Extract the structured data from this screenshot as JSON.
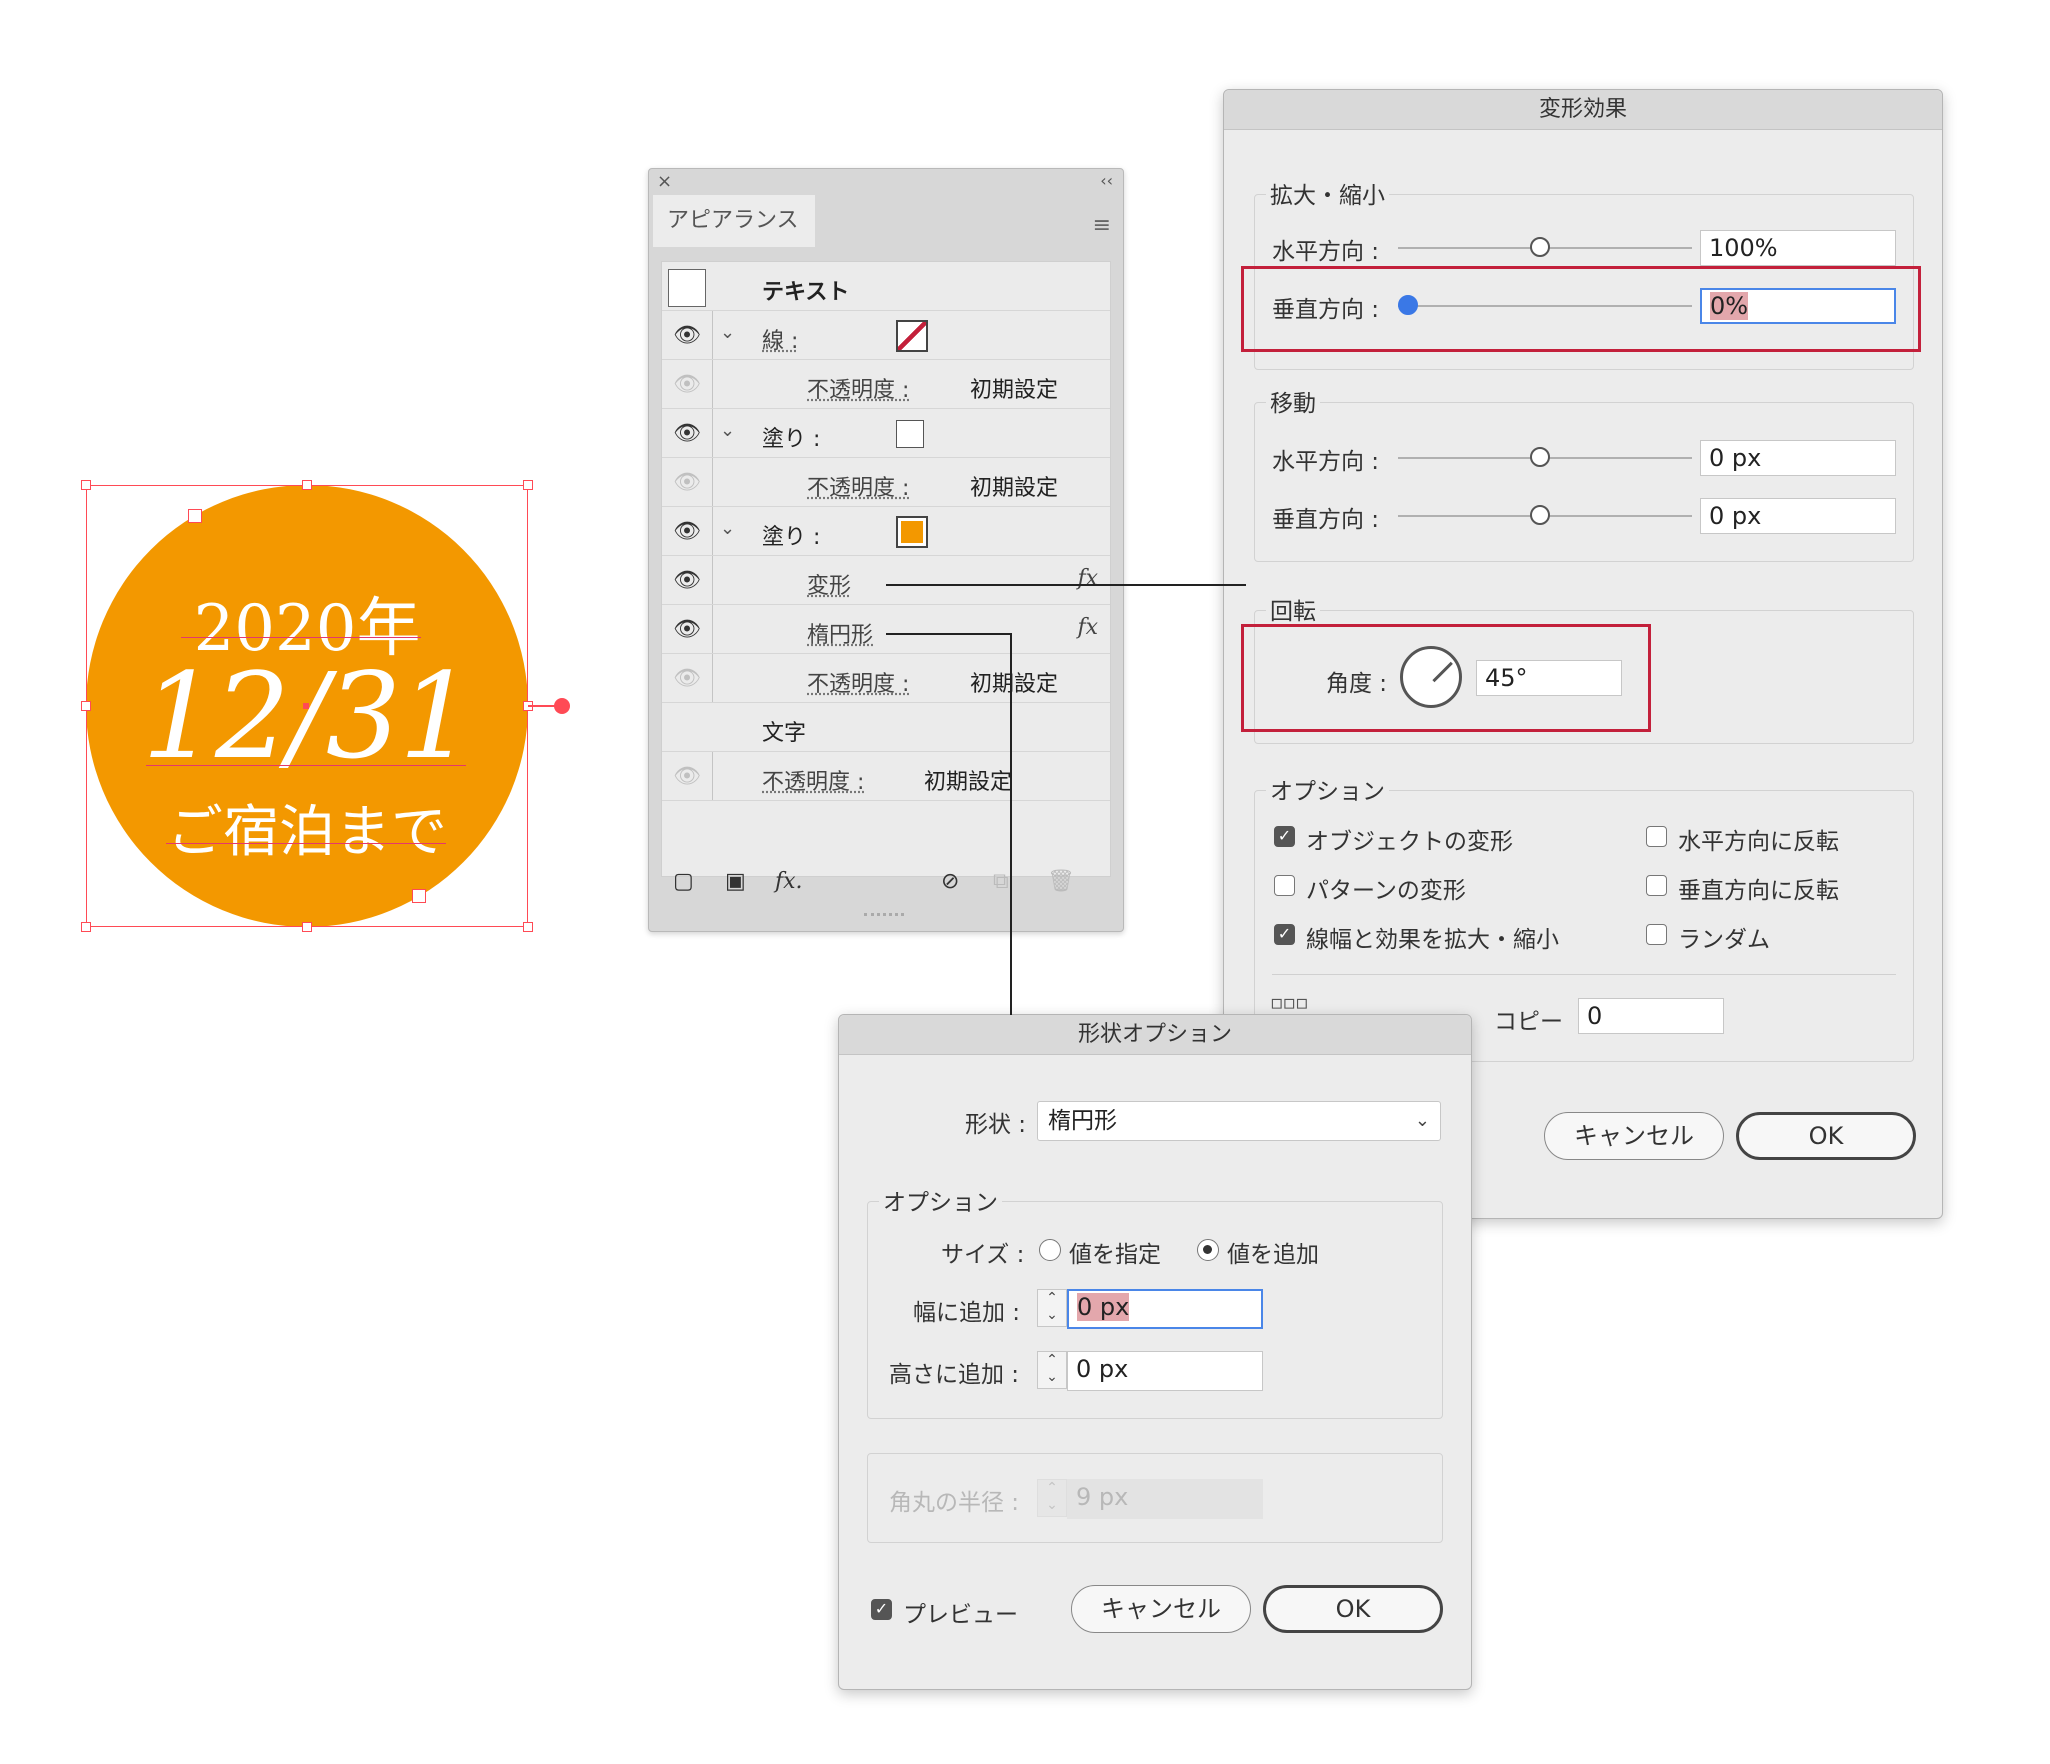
{
  "badge": {
    "year": "2020年",
    "date": "12/31",
    "sub": "ご宿泊まで",
    "fill": "#f39800"
  },
  "appearance": {
    "close": "×",
    "collapse": "‹‹",
    "tab": "アピアランス",
    "menu_icon": "≡",
    "header_label": "テキスト",
    "rows": [
      {
        "label": "線 :",
        "kind": "stroke"
      },
      {
        "label": "不透明度 :",
        "value": "初期設定"
      },
      {
        "label": "塗り :",
        "kind": "fill-white"
      },
      {
        "label": "不透明度 :",
        "value": "初期設定"
      },
      {
        "label": "塗り :",
        "kind": "fill-orange"
      },
      {
        "label": "変形",
        "fx": "fx"
      },
      {
        "label": "楕円形",
        "fx": "fx"
      },
      {
        "label": "不透明度 :",
        "value": "初期設定"
      },
      {
        "label": "文字"
      },
      {
        "label": "不透明度 :",
        "value": "初期設定"
      }
    ],
    "footer": {
      "fx": "fx."
    }
  },
  "transform_dialog": {
    "title": "変形効果",
    "scale_group": "拡大・縮小",
    "scale_h_label": "水平方向 :",
    "scale_h_value": "100%",
    "scale_v_label": "垂直方向 :",
    "scale_v_value": "0%",
    "move_group": "移動",
    "move_h_label": "水平方向 :",
    "move_h_value": "0 px",
    "move_v_label": "垂直方向 :",
    "move_v_value": "0 px",
    "rotate_group": "回転",
    "angle_label": "角度 :",
    "angle_value": "45°",
    "options_group": "オプション",
    "opt_object": "オブジェクトの変形",
    "opt_pattern": "パターンの変形",
    "opt_stroke": "線幅と効果を拡大・縮小",
    "opt_flip_h": "水平方向に反転",
    "opt_flip_v": "垂直方向に反転",
    "opt_random": "ランダム",
    "copy_label": "コピー",
    "copy_value": "0",
    "cancel": "キャンセル",
    "ok": "OK",
    "highlight_color": "#c3203b"
  },
  "shape_dialog": {
    "title": "形状オプション",
    "shape_label": "形状 :",
    "shape_value": "楕円形",
    "options_group": "オプション",
    "size_label": "サイズ :",
    "size_absolute": "値を指定",
    "size_relative": "値を追加",
    "width_label": "幅に追加 :",
    "width_value": "0 px",
    "height_label": "高さに追加 :",
    "height_value": "0 px",
    "radius_label": "角丸の半径 :",
    "radius_value": "9 px",
    "preview": "プレビュー",
    "cancel": "キャンセル",
    "ok": "OK"
  }
}
